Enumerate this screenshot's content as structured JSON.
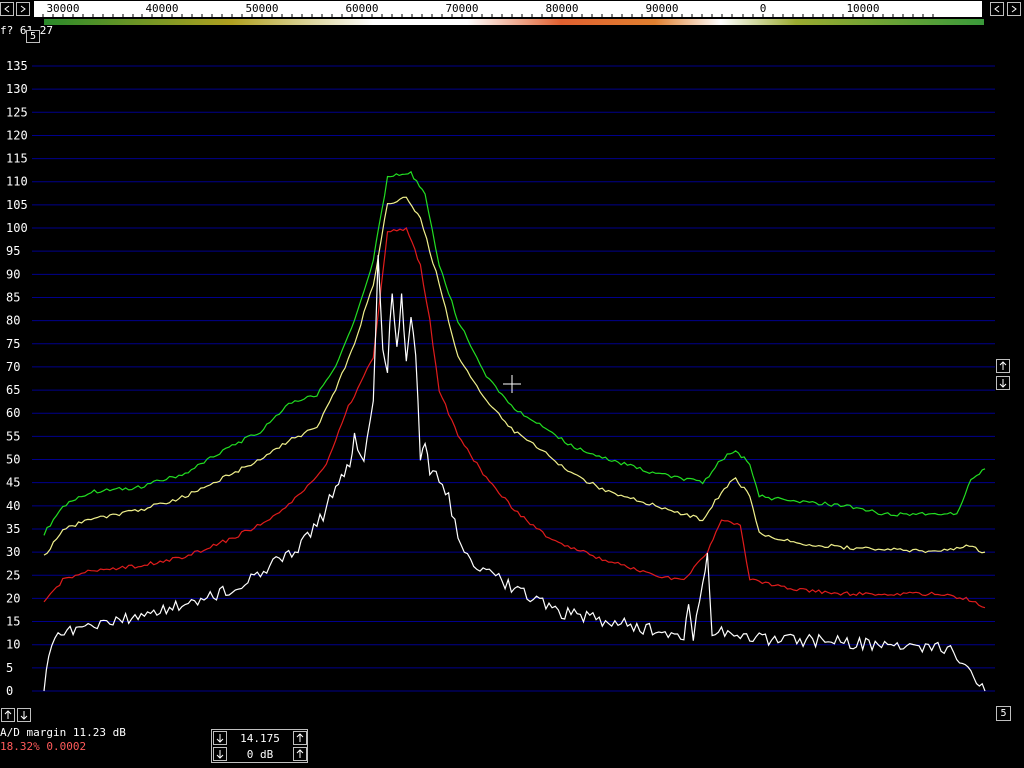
{
  "top_scale": {
    "ticks": [
      "30000",
      "40000",
      "50000",
      "60000",
      "70000",
      "80000",
      "90000",
      "0",
      "10000"
    ],
    "left_buttons": [
      "<",
      ">"
    ],
    "right_buttons": [
      "<",
      ">"
    ]
  },
  "readout": {
    "text": "f? 61.27",
    "box_value": "5"
  },
  "y_axis_labels": [
    "135",
    "130",
    "125",
    "120",
    "115",
    "110",
    "105",
    "100",
    "95",
    "90",
    "85",
    "80",
    "75",
    "70",
    "65",
    "60",
    "55",
    "50",
    "45",
    "40",
    "35",
    "30",
    "25",
    "20",
    "15",
    "10",
    "5",
    "0"
  ],
  "colors": {
    "grid": "#00008b",
    "green": "#22dd22",
    "yellow": "#f0f08c",
    "red": "#e01c1c",
    "white": "#ffffff",
    "status_red": "#ff5a5a"
  },
  "status": {
    "line1": "A/D margin 11.23 dB",
    "line2": "18.32% 0.0002"
  },
  "control": {
    "frequency": "14.175",
    "gain": "0 dB"
  },
  "right_zoom_buttons": [
    "up",
    "down"
  ],
  "bottom_right_box": "5",
  "chart_data": {
    "type": "line",
    "ylim": [
      0,
      135
    ],
    "series": [
      {
        "color": "green",
        "points": [
          [
            0,
            34
          ],
          [
            0.02,
            40
          ],
          [
            0.05,
            43
          ],
          [
            0.1,
            44
          ],
          [
            0.15,
            47
          ],
          [
            0.2,
            53
          ],
          [
            0.23,
            56
          ],
          [
            0.26,
            62
          ],
          [
            0.29,
            64
          ],
          [
            0.31,
            70
          ],
          [
            0.33,
            80
          ],
          [
            0.35,
            93
          ],
          [
            0.365,
            111
          ],
          [
            0.39,
            112
          ],
          [
            0.405,
            107
          ],
          [
            0.42,
            92
          ],
          [
            0.44,
            80
          ],
          [
            0.47,
            68
          ],
          [
            0.5,
            61
          ],
          [
            0.53,
            57
          ],
          [
            0.56,
            53
          ],
          [
            0.6,
            50
          ],
          [
            0.65,
            47
          ],
          [
            0.7,
            45
          ],
          [
            0.72,
            50
          ],
          [
            0.735,
            52
          ],
          [
            0.75,
            49
          ],
          [
            0.76,
            42
          ],
          [
            0.8,
            41
          ],
          [
            0.85,
            40
          ],
          [
            0.9,
            38
          ],
          [
            0.95,
            38.5
          ],
          [
            0.97,
            38
          ],
          [
            0.985,
            46
          ],
          [
            1,
            48
          ]
        ]
      },
      {
        "color": "yellow",
        "points": [
          [
            0,
            29
          ],
          [
            0.02,
            35
          ],
          [
            0.05,
            37
          ],
          [
            0.1,
            39
          ],
          [
            0.15,
            42
          ],
          [
            0.2,
            47
          ],
          [
            0.23,
            50
          ],
          [
            0.26,
            54
          ],
          [
            0.29,
            57
          ],
          [
            0.31,
            65
          ],
          [
            0.33,
            75
          ],
          [
            0.35,
            88
          ],
          [
            0.365,
            105
          ],
          [
            0.385,
            107
          ],
          [
            0.4,
            102
          ],
          [
            0.42,
            88
          ],
          [
            0.44,
            72
          ],
          [
            0.47,
            63
          ],
          [
            0.5,
            56
          ],
          [
            0.53,
            52
          ],
          [
            0.56,
            47
          ],
          [
            0.6,
            43
          ],
          [
            0.65,
            40
          ],
          [
            0.7,
            37
          ],
          [
            0.72,
            43
          ],
          [
            0.735,
            46
          ],
          [
            0.75,
            42
          ],
          [
            0.76,
            34
          ],
          [
            0.8,
            32
          ],
          [
            0.85,
            31
          ],
          [
            0.9,
            30.5
          ],
          [
            0.95,
            30
          ],
          [
            0.98,
            31.5
          ],
          [
            1,
            30
          ]
        ]
      },
      {
        "color": "red",
        "points": [
          [
            0,
            19
          ],
          [
            0.02,
            24
          ],
          [
            0.05,
            26
          ],
          [
            0.1,
            27
          ],
          [
            0.15,
            29
          ],
          [
            0.2,
            33
          ],
          [
            0.24,
            37
          ],
          [
            0.27,
            42
          ],
          [
            0.3,
            49
          ],
          [
            0.32,
            60
          ],
          [
            0.35,
            72
          ],
          [
            0.365,
            99
          ],
          [
            0.385,
            100
          ],
          [
            0.4,
            92
          ],
          [
            0.41,
            80
          ],
          [
            0.42,
            65
          ],
          [
            0.44,
            55
          ],
          [
            0.47,
            46
          ],
          [
            0.5,
            39
          ],
          [
            0.53,
            34
          ],
          [
            0.56,
            31
          ],
          [
            0.6,
            28
          ],
          [
            0.65,
            25
          ],
          [
            0.68,
            24
          ],
          [
            0.705,
            30
          ],
          [
            0.72,
            37
          ],
          [
            0.74,
            36
          ],
          [
            0.75,
            24
          ],
          [
            0.8,
            22
          ],
          [
            0.85,
            21
          ],
          [
            0.9,
            21
          ],
          [
            0.95,
            21
          ],
          [
            0.98,
            20
          ],
          [
            1,
            18
          ]
        ]
      },
      {
        "color": "white",
        "points": [
          [
            0,
            0
          ],
          [
            0.005,
            8
          ],
          [
            0.015,
            13
          ],
          [
            0.05,
            14
          ],
          [
            0.1,
            16
          ],
          [
            0.15,
            19
          ],
          [
            0.2,
            22
          ],
          [
            0.24,
            27
          ],
          [
            0.27,
            31
          ],
          [
            0.3,
            39
          ],
          [
            0.31,
            45
          ],
          [
            0.325,
            49
          ],
          [
            0.33,
            55
          ],
          [
            0.34,
            49
          ],
          [
            0.35,
            62
          ],
          [
            0.355,
            93
          ],
          [
            0.36,
            75
          ],
          [
            0.365,
            70
          ],
          [
            0.37,
            87
          ],
          [
            0.375,
            75
          ],
          [
            0.38,
            85
          ],
          [
            0.385,
            70
          ],
          [
            0.39,
            80
          ],
          [
            0.395,
            72
          ],
          [
            0.4,
            51
          ],
          [
            0.405,
            53
          ],
          [
            0.41,
            47
          ],
          [
            0.42,
            46
          ],
          [
            0.43,
            42
          ],
          [
            0.44,
            33
          ],
          [
            0.46,
            27
          ],
          [
            0.5,
            22
          ],
          [
            0.55,
            17
          ],
          [
            0.6,
            15
          ],
          [
            0.65,
            13
          ],
          [
            0.68,
            12
          ],
          [
            0.685,
            20
          ],
          [
            0.69,
            12
          ],
          [
            0.7,
            24
          ],
          [
            0.705,
            30
          ],
          [
            0.71,
            13
          ],
          [
            0.75,
            11.5
          ],
          [
            0.8,
            11
          ],
          [
            0.85,
            10.5
          ],
          [
            0.9,
            10
          ],
          [
            0.95,
            9.5
          ],
          [
            0.97,
            8
          ],
          [
            0.985,
            4
          ],
          [
            1,
            0
          ]
        ]
      }
    ]
  }
}
